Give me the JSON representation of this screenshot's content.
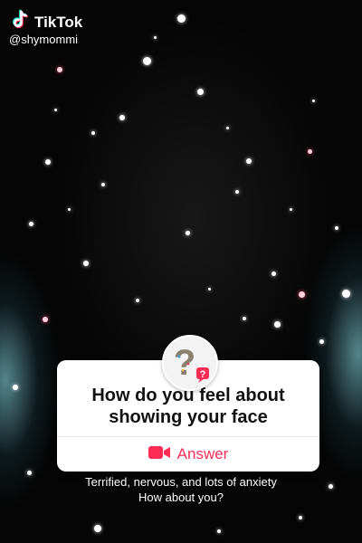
{
  "brand": {
    "name": "TikTok",
    "handle": "@shymommi",
    "logo_icon": "tiktok-note-icon"
  },
  "question_card": {
    "question": "How do you feel about showing your face",
    "avatar_icon": "question-mark-avatar-icon",
    "answer_label": "Answer",
    "answer_icon": "video-camera-icon"
  },
  "caption": {
    "line1": "Terrified, nervous, and lots of anxiety",
    "line2": "How about you?"
  },
  "colors": {
    "accent": "#fe2c55",
    "card_background": "#ffffff",
    "background": "#050505"
  }
}
